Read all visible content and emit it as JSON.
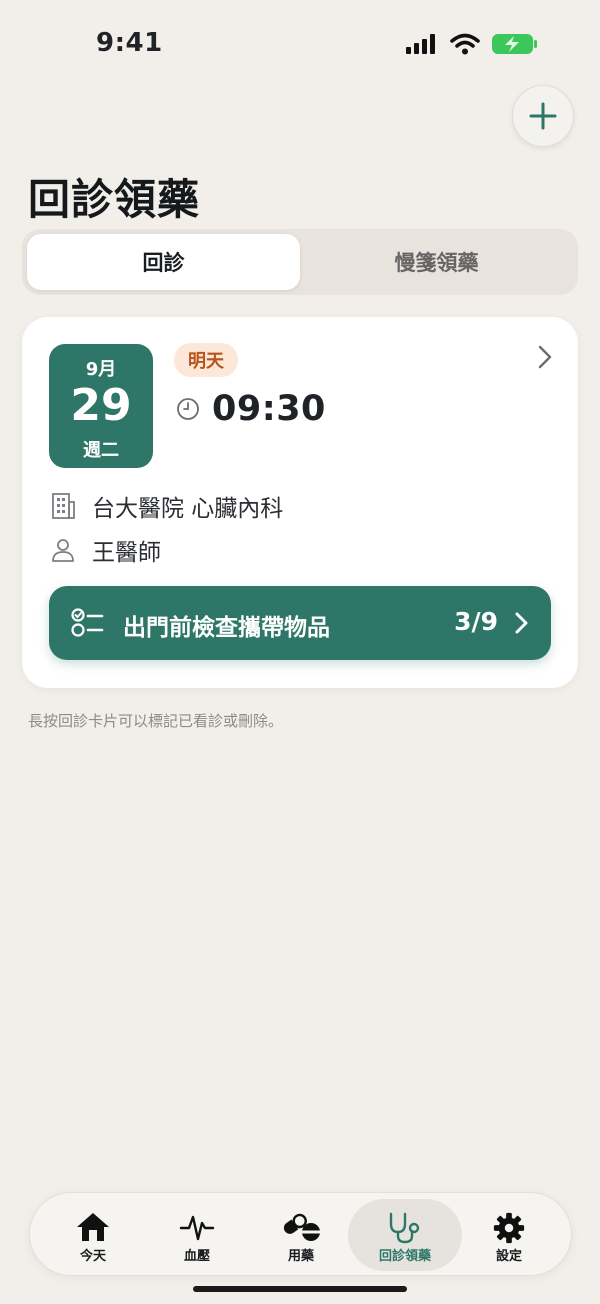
{
  "status_bar": {
    "time": "9:41"
  },
  "header": {
    "title": "回診領藥",
    "add_icon": "plus-icon"
  },
  "segment": {
    "tabs": [
      {
        "label": "回診",
        "active": true
      },
      {
        "label": "慢箋領藥",
        "active": false
      }
    ]
  },
  "appointment": {
    "month": "9月",
    "day": "29",
    "weekday": "週二",
    "badge": "明天",
    "time": "09:30",
    "hospital": "台大醫院 心臟內科",
    "doctor": "王醫師",
    "checklist": {
      "label": "出門前檢查攜帶物品",
      "count": "3/9"
    }
  },
  "hint": "長按回診卡片可以標記已看診或刪除。",
  "tabbar": {
    "items": [
      {
        "label": "今天",
        "icon": "home-icon",
        "active": false
      },
      {
        "label": "血壓",
        "icon": "heartbeat-icon",
        "active": false
      },
      {
        "label": "用藥",
        "icon": "pills-icon",
        "active": false
      },
      {
        "label": "回診領藥",
        "icon": "stethoscope-icon",
        "active": true
      },
      {
        "label": "設定",
        "icon": "gear-icon",
        "active": false
      }
    ]
  },
  "colors": {
    "accent": "#2E7768",
    "background": "#F2EFEA",
    "badge_bg": "#FCE7D8",
    "badge_text": "#B5541B"
  }
}
